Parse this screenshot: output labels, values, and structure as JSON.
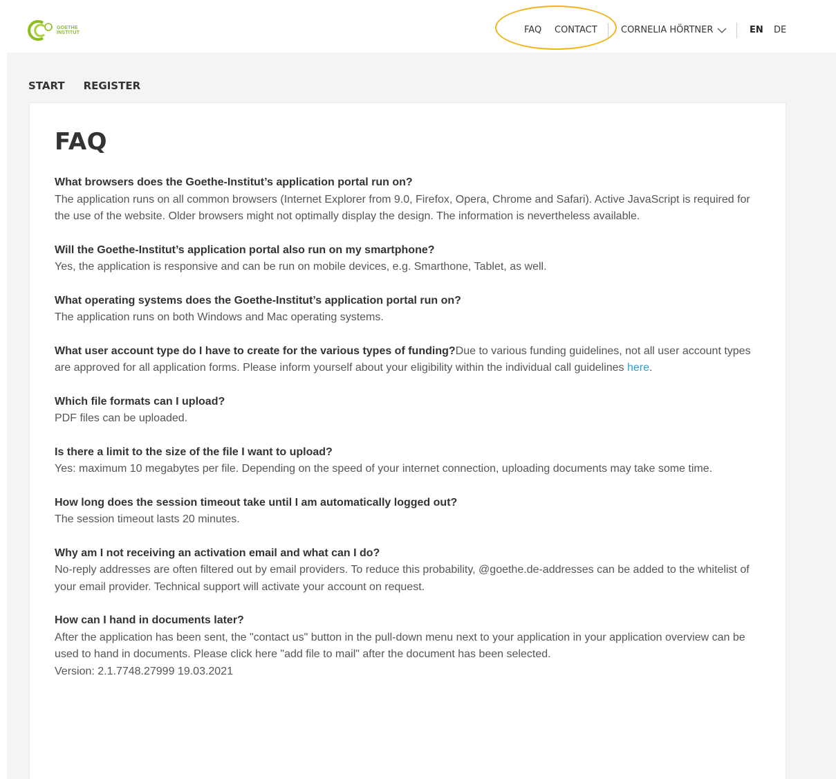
{
  "header": {
    "logo_line1": "GOETHE",
    "logo_line2": "INSTITUT",
    "nav_faq": "FAQ",
    "nav_contact": "CONTACT",
    "user_name": "CORNELIA HÖRTNER",
    "lang_en": "EN",
    "lang_de": "DE"
  },
  "breadcrumb": {
    "start": "START",
    "register": "REGISTER"
  },
  "page": {
    "title": "FAQ"
  },
  "faq": [
    {
      "q": "What browsers does the Goethe-Institut’s application portal run on?",
      "a": "The application runs on all common browsers (Internet Explorer from 9.0, Firefox, Opera, Chrome and Safari). Active JavaScript is required for the use of the website. Older browsers might not optimally display the design. The information is nevertheless available."
    },
    {
      "q": "Will the Goethe-Institut’s application portal also run on my smartphone?",
      "a": "Yes, the application is responsive and can be run on mobile devices, e.g. Smarthone, Tablet, as well."
    },
    {
      "q": "What operating systems does the Goethe-Institut’s application portal run on?",
      "a": "The application runs on both Windows and Mac operating systems."
    },
    {
      "q": "What user account type do I have to create for the various types of funding?",
      "a": "Due to various funding guidelines, not all user account types are approved for all application forms. Please inform yourself about your eligibility within the individual call guidelines ",
      "link": "here",
      "after": "."
    },
    {
      "q": "Which file formats can I upload?",
      "a": "PDF files can be uploaded."
    },
    {
      "q": "Is there a limit to the size of the file I want to upload?",
      "a": "Yes: maximum 10 megabytes per file. Depending on the speed of your internet connection, uploading documents may take some time."
    },
    {
      "q": "How long does the session timeout take until I am automatically logged out?",
      "a": "The session timeout lasts 20 minutes."
    },
    {
      "q": "Why am I not receiving an activation email and what can I do?",
      "a": "No-reply addresses are often filtered out by email providers. To reduce this probability, @goethe.de-addresses can be added to the whitelist of your email provider. Technical support will activate your account on request."
    },
    {
      "q": "How can I hand in documents later?",
      "a": "After the application has been sent, the \"contact us\" button in the pull-down menu next to your application in your application overview can be used to hand in documents. Please click here \"add file to mail\" after the document has been selected.",
      "version": "Version: 2.1.7748.27999 19.03.2021"
    }
  ],
  "colors": {
    "brand_green": "#8cbe1e",
    "link_blue": "#2b9fd6",
    "highlight_ring": "#f2b418",
    "page_gray": "#f4f4f4"
  }
}
